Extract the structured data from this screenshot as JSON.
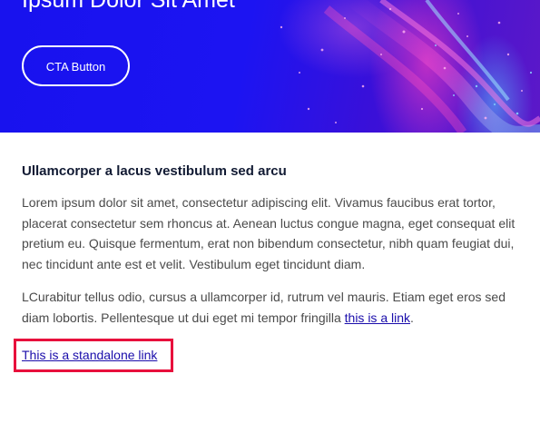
{
  "hero": {
    "title": "Ipsum Dolor Sit Amet",
    "cta_label": "CTA Button",
    "background_color": "#1a10f0",
    "accent_pink": "#ff3cbe",
    "accent_cyan": "#5ac8ff"
  },
  "content": {
    "heading": "Ullamcorper a lacus vestibulum sed arcu",
    "paragraph1": "Lorem ipsum dolor sit amet, consectetur adipiscing elit. Vivamus faucibus erat tortor, placerat consectetur sem rhoncus at. Aenean luctus congue magna, eget consequat elit pretium eu. Quisque fermentum, erat non bibendum consectetur, nibh quam feugiat dui, nec tincidunt ante est et velit. Vestibulum eget tincidunt diam.",
    "paragraph2_text": "LCurabitur tellus odio, cursus a ullamcorper id, rutrum vel mauris. Etiam eget eros sed diam lobortis. Pellentesque ut dui eget mi tempor fringilla ",
    "paragraph2_link": "this is a link",
    "paragraph2_end": ".",
    "standalone_link": "This is a standalone link"
  },
  "colors": {
    "link": "#1a0dab",
    "highlight_border": "#e8103c",
    "heading": "#111a33",
    "body_text": "#4a4a4a"
  }
}
